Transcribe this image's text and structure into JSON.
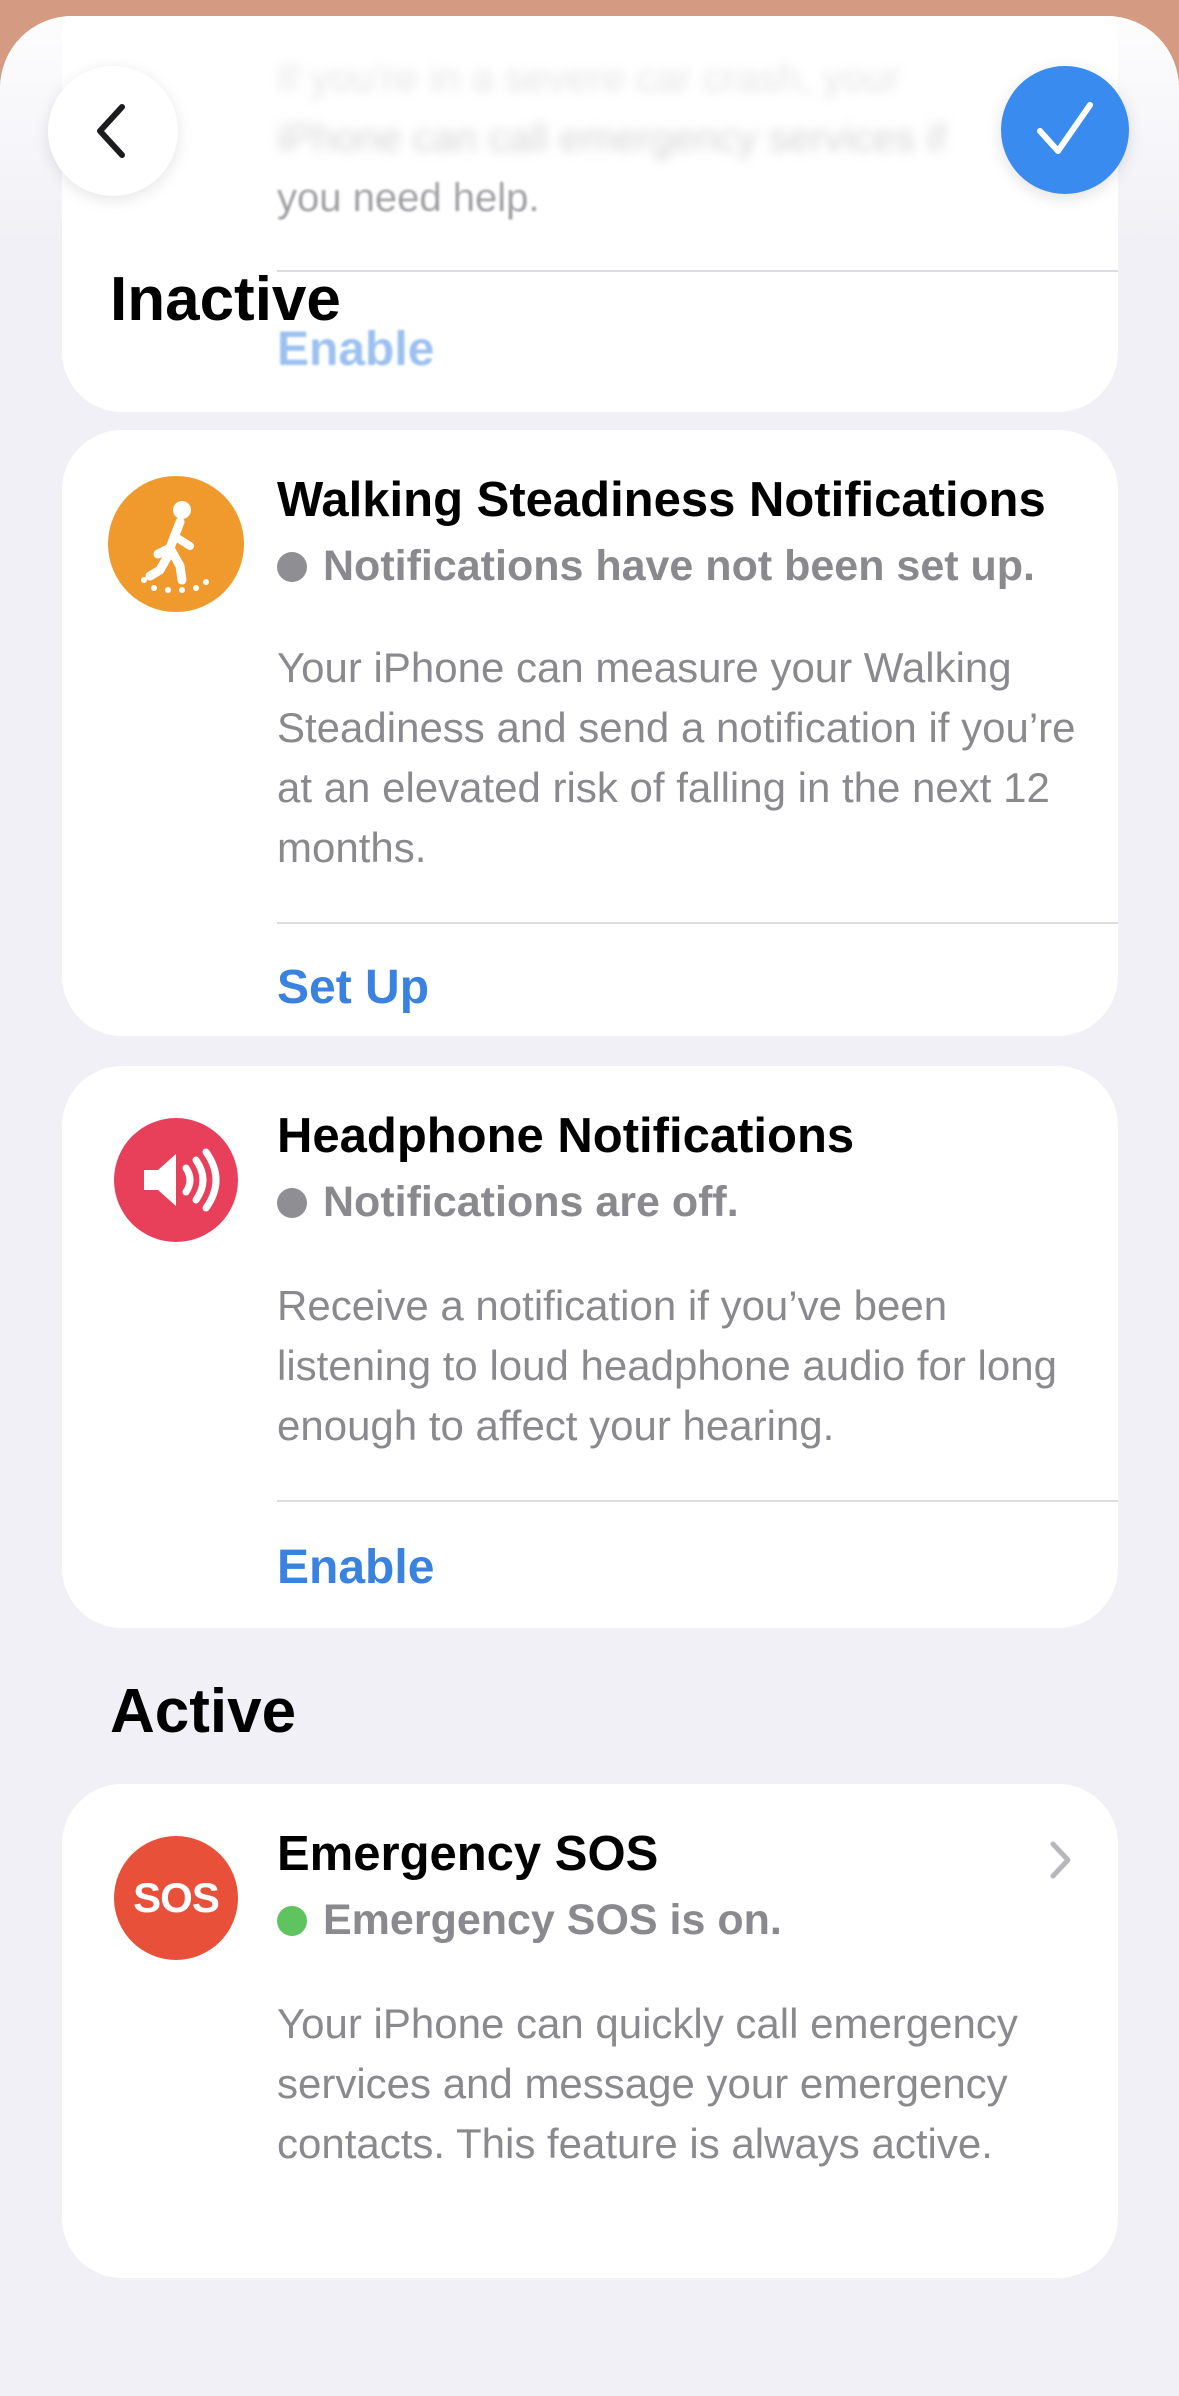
{
  "top_card": {
    "blurred_text_lines": [
      "If you're in a severe car crash, your",
      "iPhone can call emergency services if",
      "you need help."
    ],
    "link": "Enable"
  },
  "sections": {
    "inactive_heading": "Inactive",
    "active_heading": "Active"
  },
  "walking": {
    "title": "Walking Steadiness Notifications",
    "status": "Notifications have not been set up.",
    "description": "Your iPhone can measure your Walking Steadiness and send a notification if you’re at an elevated risk of falling in the next 12 months.",
    "action": "Set Up",
    "icon": "walking-figure-icon",
    "icon_color": "#f09a2e",
    "status_color": "#8e8e93"
  },
  "headphone": {
    "title": "Headphone Notifications",
    "status": "Notifications are off.",
    "description": "Receive a notification if you’ve been listening to loud headphone audio for long enough to affect your hearing.",
    "action": "Enable",
    "icon": "speaker-icon",
    "icon_color": "#e8405a",
    "status_color": "#8e8e93"
  },
  "sos": {
    "title": "Emergency SOS",
    "status": "Emergency SOS is on.",
    "description": "Your iPhone can quickly call emergency services and message your emergency contacts. This feature is always active.",
    "badge": "SOS",
    "icon_color": "#e8503a",
    "status_color": "#5fc35f"
  },
  "colors": {
    "accent": "#3a82e0",
    "done_button": "#3a8bf0",
    "background": "#f1f0f6"
  }
}
